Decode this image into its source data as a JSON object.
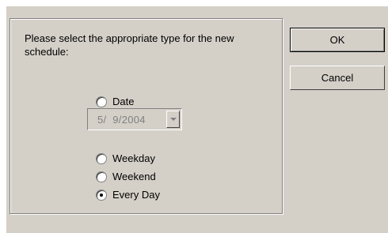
{
  "dialog": {
    "prompt": "Please select the appropriate type for the new schedule:",
    "date_option": {
      "label": "Date",
      "selected": false
    },
    "date_picker": {
      "value": "5/  9/2004",
      "enabled": false
    },
    "options": [
      {
        "label": "Weekday",
        "selected": false
      },
      {
        "label": "Weekend",
        "selected": false
      },
      {
        "label": "Every Day",
        "selected": true
      }
    ],
    "buttons": {
      "ok_label": "OK",
      "cancel_label": "Cancel"
    }
  },
  "colors": {
    "dialog_background": "#d4d0c8",
    "disabled_text": "#808080",
    "border_dark": "#808080",
    "border_light": "#ffffff"
  },
  "icons": {
    "dropdown": "chevron-down-icon",
    "radio": "radio-button"
  }
}
